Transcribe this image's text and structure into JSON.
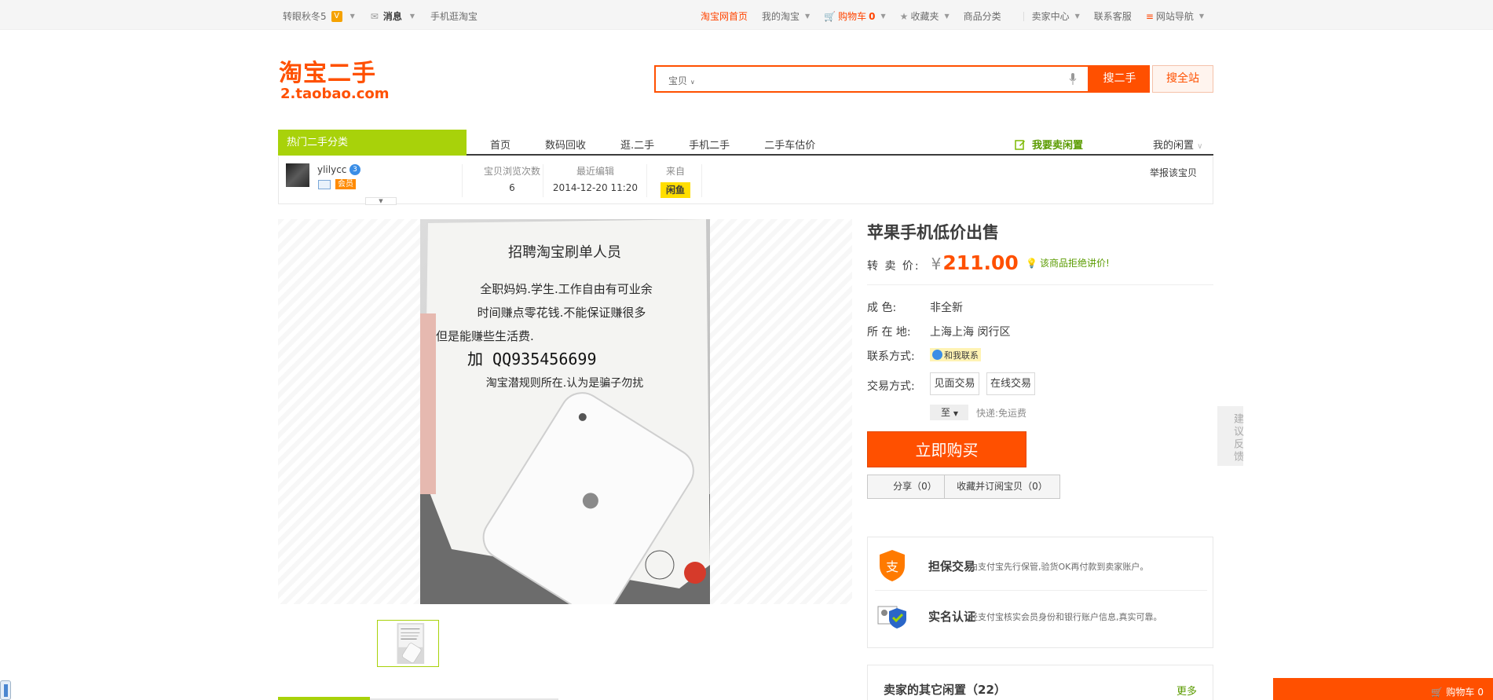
{
  "topbar": {
    "left": {
      "user": "转眼秋冬5",
      "messages": "消息",
      "mobile": "手机逛淘宝"
    },
    "right": {
      "home": "淘宝网首页",
      "my_taobao": "我的淘宝",
      "cart": "购物车",
      "cart_count": "0",
      "favorites": "收藏夹",
      "categories": "商品分类",
      "seller_center": "卖家中心",
      "service": "联系客服",
      "site_nav": "网站导航"
    }
  },
  "header": {
    "logo_cn": "淘宝二手",
    "logo_en": "2.taobao.com",
    "search_scope": "宝贝",
    "search_value": "",
    "search_button": "搜二手",
    "search_all_button": "搜全站"
  },
  "nav": {
    "category_header": "热门二手分类",
    "tabs": [
      "首页",
      "数码回收",
      "逛.二手",
      "手机二手",
      "二手车估价"
    ],
    "sell": "我要卖闲置",
    "mine": "我的闲置"
  },
  "seller": {
    "name": "ylilycc",
    "member": "会员",
    "views_label": "宝贝浏览次数",
    "views": "6",
    "edited_label": "最近编辑",
    "edited": "2014-12-20 11:20",
    "from_label": "来自",
    "from_badge": "闲鱼",
    "report": "举报该宝贝"
  },
  "photo": {
    "note_lines": [
      "招聘淘宝刷单人员",
      "全职妈妈.学生.工作自由有可业余",
      "时间赚点零花钱.不能保证赚很多",
      "但是能赚些生活费.",
      "加 QQ935456699",
      "淘宝潜规则所在.认为是骗子勿扰"
    ]
  },
  "product": {
    "title": "苹果手机低价出售",
    "price_label": "转 卖 价:",
    "currency": "¥",
    "price": "211.00",
    "no_bargain": "该商品拒绝讲价!",
    "condition_label": "成 色:",
    "condition": "非全新",
    "location_label": "所 在 地:",
    "location": "上海上海 闵行区",
    "contact_label": "联系方式:",
    "contact": "和我联系",
    "trade_label": "交易方式:",
    "trade_options": [
      "见面交易",
      "在线交易"
    ],
    "ship_to": "至",
    "ship_fee": "快递:免运费",
    "buy_button": "立即购买",
    "share_button": "分享（0）",
    "fav_button": "收藏并订阅宝贝（0）"
  },
  "trust": {
    "escrow_title": "担保交易",
    "escrow_desc": "由支付宝先行保管,验货OK再付款到卖家账户。",
    "realname_title": "实名认证",
    "realname_desc": "经支付宝核实会员身份和银行账户信息,真实可靠。"
  },
  "others": {
    "title": "卖家的其它闲置（22）",
    "more": "更多"
  },
  "side": {
    "feedback": "建议反馈",
    "cart_label": "购物车",
    "cart_count": "0"
  },
  "colors": {
    "brand": "#ff5000",
    "green": "#a8d20a",
    "link_green": "#5a9b00"
  }
}
